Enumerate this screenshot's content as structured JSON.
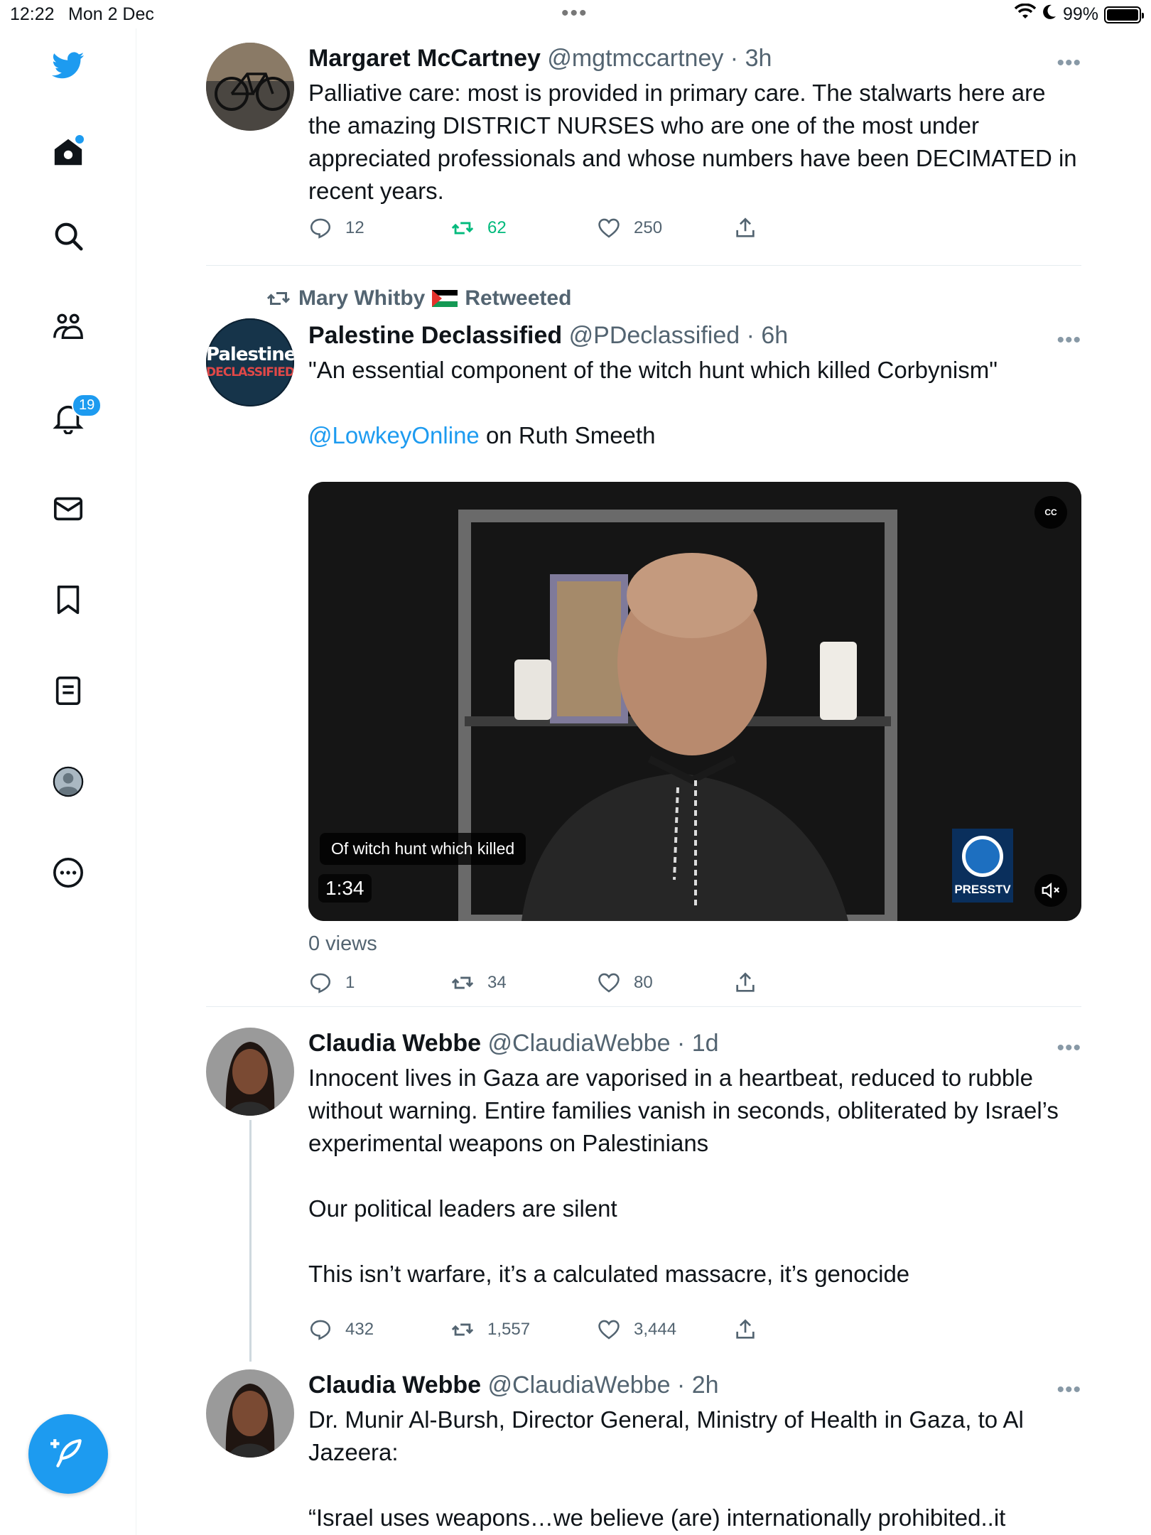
{
  "status_bar": {
    "time": "12:22",
    "date": "Mon 2 Dec",
    "multitask_dots": "•••",
    "battery": "99%"
  },
  "sidebar": {
    "notifications_badge": "19",
    "accent_color": "#1d9bf0"
  },
  "tweets": [
    {
      "name": "Margaret McCartney",
      "handle": "@mgtmccartney",
      "time": "3h",
      "more": "•••",
      "text": "Palliative care: most is provided in primary care. The stalwarts here are the amazing DISTRICT NURSES who are one of the most under appreciated professionals and whose numbers have been DECIMATED in recent years.",
      "replies": "12",
      "retweets": "62",
      "likes": "250",
      "retweeted_by_me": true
    },
    {
      "retweeted_by": "Mary Whitby",
      "retweeted_label": "Retweeted",
      "name": "Palestine Declassified",
      "handle": "@PDeclassified",
      "time": "6h",
      "more": "•••",
      "avatar_text_1": "Palestine",
      "avatar_text_2": "DECLASSIFIED",
      "text_line1": "\"An essential component of the witch hunt which killed Corbynism\"",
      "mention": "@LowkeyOnline",
      "text_line2": " on Ruth Smeeth",
      "video_caption": "Of witch hunt which killed",
      "video_duration": "1:34",
      "cc_label": "CC",
      "watermark": "PRESSTV",
      "views": "0 views",
      "replies": "1",
      "retweets": "34",
      "likes": "80"
    },
    {
      "name": "Claudia Webbe",
      "handle": "@ClaudiaWebbe",
      "time": "1d",
      "more": "•••",
      "text": "Innocent lives in Gaza are vaporised in a heartbeat, reduced to rubble without warning. Entire families vanish in seconds, obliterated by Israel’s experimental weapons on Palestinians\n\nOur political leaders are silent\n\nThis isn’t warfare, it’s a calculated massacre, it’s genocide",
      "replies": "432",
      "retweets": "1,557",
      "likes": "3,444"
    },
    {
      "name": "Claudia Webbe",
      "handle": "@ClaudiaWebbe",
      "time": "2h",
      "more": "•••",
      "text": "Dr. Munir Al-Bursh, Director General, Ministry of Health in Gaza, to Al Jazeera:\n\n“Israel uses weapons…we believe (are) internationally prohibited..it"
    }
  ]
}
